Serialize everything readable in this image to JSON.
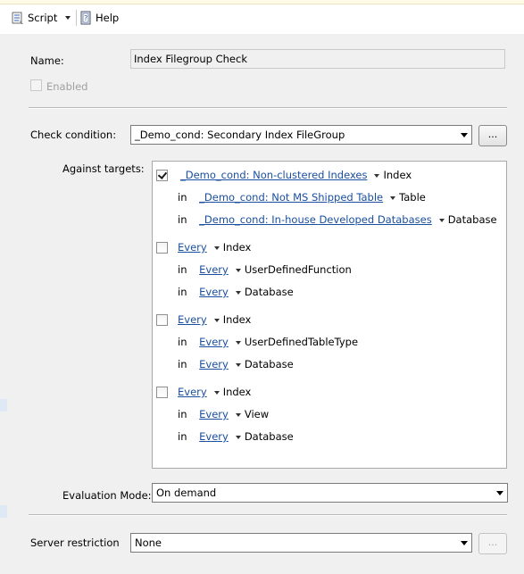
{
  "toolbar": {
    "script_label": "Script",
    "help_label": "Help"
  },
  "form": {
    "name_label": "Name:",
    "name_value": "Index Filegroup Check",
    "enabled_label": "Enabled",
    "enabled_checked": false,
    "check_condition_label": "Check condition:",
    "check_condition_value": "_Demo_cond: Secondary Index FileGroup",
    "check_condition_button": "...",
    "against_targets_label": "Against targets:",
    "evaluation_mode_label": "Evaluation Mode:",
    "evaluation_mode_value": "On demand",
    "server_restriction_label": "Server restriction",
    "server_restriction_value": "None",
    "server_restriction_button": "..."
  },
  "targets": [
    {
      "checked": true,
      "rows": [
        {
          "prefix": "",
          "link": "_Demo_cond: Non-clustered Indexes",
          "type": "Index"
        },
        {
          "prefix": "in",
          "link": "_Demo_cond: Not MS Shipped Table",
          "type": "Table"
        },
        {
          "prefix": "in",
          "link": "_Demo_cond: In-house Developed Databases",
          "type": "Database"
        }
      ]
    },
    {
      "checked": false,
      "rows": [
        {
          "prefix": "",
          "link": "Every",
          "type": "Index"
        },
        {
          "prefix": "in",
          "link": "Every",
          "type": "UserDefinedFunction"
        },
        {
          "prefix": "in",
          "link": "Every",
          "type": "Database"
        }
      ]
    },
    {
      "checked": false,
      "rows": [
        {
          "prefix": "",
          "link": "Every",
          "type": "Index"
        },
        {
          "prefix": "in",
          "link": "Every",
          "type": "UserDefinedTableType"
        },
        {
          "prefix": "in",
          "link": "Every",
          "type": "Database"
        }
      ]
    },
    {
      "checked": false,
      "rows": [
        {
          "prefix": "",
          "link": "Every",
          "type": "Index"
        },
        {
          "prefix": "in",
          "link": "Every",
          "type": "View"
        },
        {
          "prefix": "in",
          "link": "Every",
          "type": "Database"
        }
      ]
    }
  ],
  "icons": {
    "script": "script-icon",
    "help": "help-book-icon"
  }
}
